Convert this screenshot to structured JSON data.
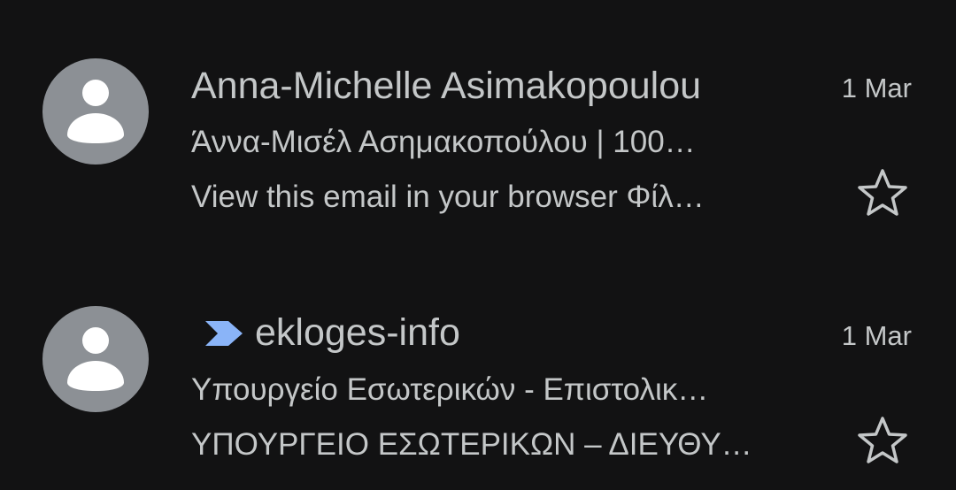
{
  "emails": [
    {
      "sender": "Anna-Michelle Asimakopoulou",
      "date": "1 Mar",
      "subject": "Άννα-Μισέλ Ασημακοπούλου | 100…",
      "snippet": "View this email in your browser Φίλ…",
      "starred": false,
      "important": false,
      "avatar_icon": "person-icon"
    },
    {
      "sender": "ekloges-info",
      "date": "1 Mar",
      "subject": "Υπουργείο Εσωτερικών - Επιστολικ…",
      "snippet": "ΥΠΟΥΡΓΕΙΟ ΕΣΩΤΕΡΙΚΩΝ – ΔΙΕΥΘΥ…",
      "starred": false,
      "important": true,
      "avatar_icon": "person-icon"
    }
  ],
  "colors": {
    "background": "#121213",
    "text": "#c4c7c8",
    "avatar": "#8c9095",
    "important_marker": "#8ab4f8"
  }
}
